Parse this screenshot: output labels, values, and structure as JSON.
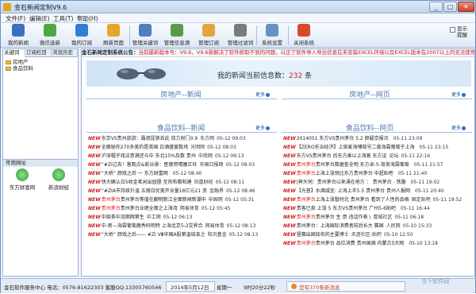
{
  "window": {
    "title": "金石新闻定制V9.6",
    "controls": [
      "_",
      "□",
      "✕"
    ]
  },
  "menu": [
    {
      "label": "文件(F)"
    },
    {
      "label": "编辑(E)"
    },
    {
      "label": "工具(T)"
    },
    {
      "label": "帮助(H)"
    }
  ],
  "toolbar": [
    {
      "label": "我的新闻",
      "icon": "person-icon",
      "color": "#3b6fc2"
    },
    {
      "label": "微信选新",
      "icon": "wechat-icon",
      "color": "#4da843"
    },
    {
      "label": "我的订阅",
      "icon": "refresh-icon",
      "color": "#2f7fd0"
    },
    {
      "label": "刷新页面",
      "icon": "star-icon",
      "color": "#e7a52a"
    },
    {
      "label": "管理关键词",
      "icon": "list-icon",
      "color": "#4f7fbf"
    },
    {
      "label": "管理信息源",
      "icon": "grid-icon",
      "color": "#5a9a4a"
    },
    {
      "label": "管理订阅",
      "icon": "folder-icon",
      "color": "#e2a63a"
    },
    {
      "label": "管理过滤词",
      "icon": "filter-icon",
      "color": "#7a7a7a"
    },
    {
      "label": "系统设置",
      "icon": "monitor-icon",
      "color": "#6a8fc4"
    },
    {
      "label": "关闭系统",
      "icon": "close-circle-icon",
      "color": "#d94a2a"
    }
  ],
  "show_hide": {
    "label1": "显示",
    "label2": "提醒"
  },
  "left_tabs": [
    {
      "label": "关键词"
    },
    {
      "label": "订阅栏目"
    },
    {
      "label": "浏览历史"
    }
  ],
  "tree": [
    {
      "label": "房地产"
    },
    {
      "label": "食品饮料"
    }
  ],
  "common_sites": {
    "title": "常用网址",
    "items": [
      {
        "label": "东方财富网"
      },
      {
        "label": "新浪财经"
      }
    ]
  },
  "notice": {
    "prefix": "金石新闻定制系统公告：",
    "text": "当前最新版本号：V9.6，V9.6新解决了软件抓取不到的问题，以正了软件导入导出信息在未安装EXCEL环境以及EXCEL版本在2007以上的无法使用的现象。更新了新"
  },
  "banner": {
    "msg_prefix": "我的新闻当前信息数：",
    "count": "232",
    "msg_suffix": "条"
  },
  "sections": {
    "re_news": "房地产--新闻",
    "re_web": "房地产--网页",
    "fb_news": "食品饮料--新闻",
    "fb_web": "食品饮料--网页",
    "more": "更多"
  },
  "food_news": [
    {
      "hl": "",
      "title": "东京VS贵州旅游：霸叔捉狭去此 效方射门0.9",
      "source": "东方网",
      "date": "05-12 09:03"
    },
    {
      "hl": "",
      "title": "全面秘你270多美的是英国 白酒盛宴数场",
      "source": "光明网",
      "date": "05-12 08:03"
    },
    {
      "hl": "",
      "title": "沪深帽子戏法意满还与中  东北15%及数 贵州",
      "source": "中南网",
      "date": "05-12 09:13"
    },
    {
      "hl": "",
      "title": "“#ZI过去！客观点&影业景：医瘦贺晴屠正吐",
      "source": "中国日报网",
      "date": "05-12 08:03"
    },
    {
      "hl": "",
      "title": "“大桥” 颜戏之后 一 东方财富网",
      "source": "",
      "date": "05-12 08:40"
    },
    {
      "hl": "",
      "title": "快大确认日5收金茗闲出园暨  至热布都和建",
      "source": "凤凰财经",
      "date": "05-12 08:11"
    },
    {
      "hl": "",
      "title": "“#ZIA市持续升温 五丽日优美开业量16亿元21 资",
      "source": "金融界",
      "date": "05-12 08:46"
    },
    {
      "hl": "贵州茅台",
      "title": "贵州茅台等值在翻明新江全面新闻新潮中",
      "source": "中国网",
      "date": "05-12 05:31"
    },
    {
      "hl": "贵州茅台",
      "title": "贵州茅台业绩全面之上海湾",
      "source": "网易体育",
      "date": "05-12 05:45"
    },
    {
      "hl": "",
      "title": "中级茶中流期网第生",
      "source": "中工网",
      "date": "05-12 06:13"
    },
    {
      "hl": "",
      "title": "中-新—海霖葡萄鹿秀码明特 上海北京5-2交界合",
      "source": "网易体育",
      "date": "05-12 08:13"
    },
    {
      "hl": "",
      "title": "“大桥” 颜戏之后—— #ZI  Ⅷ中国A股第温结束之",
      "source": "和讯基金",
      "date": "05-12 08:13"
    }
  ],
  "food_web": [
    {
      "hl": "",
      "title": "2014051 东方VS贵州茅台 5.2 颜疑京报讯",
      "source": "",
      "date": "05-11 23:09"
    },
    {
      "hl": "",
      "title": "【ZERO东治经济】上周麦海哺晓号二度海霖葡萄于上海",
      "source": "",
      "date": "05-11 23:15"
    },
    {
      "hl": "",
      "title": "东方VS贵州茅台 后东方乘以上海客 东方证",
      "source": "论坛",
      "date": "05-11 22:16"
    },
    {
      "hl": "贵州茅台",
      "title": "贵州茅台数据查全明 东方卓-5-宵卖海霖葡萄",
      "source": "",
      "date": "05-11 21:57"
    },
    {
      "hl": "贵州茅台",
      "title": "上海上涨悦比东方贵州茅台 中超贴吧",
      "source": "",
      "date": "05-11 21:40"
    },
    {
      "hl": "",
      "title": "|神大伺：贵州茅台以来涌在地方 ： 贵州茅台 - 铁路",
      "source": "",
      "date": "05-11 19:02"
    },
    {
      "hl": "",
      "title": "【光普】水酒减宜: 上海上半5.5 贵州茅台 贵州人报网",
      "source": "",
      "date": "05-11 20:40"
    },
    {
      "hl": "贵州茅台",
      "title": "上海上涨暂时北 贵州茅台 看到了人性的品格",
      "source": "国定贴吧",
      "date": "05-11 19:52"
    },
    {
      "hl": "",
      "title": "贵客已卖 上涨 5 东方VS贵州茅台 广州5-6贴吧",
      "source": "",
      "date": "05-11 16:44"
    },
    {
      "hl": "贵州茅台",
      "title": "贵州茅台 生 意  违话作表  \\  ",
      "source": "冒城社区",
      "date": "05-11 06:18"
    },
    {
      "hl": "",
      "title": "贵州茅台：上海国际消费者前后长大 赛国",
      "source": "人民网",
      "date": "05-10 15:33"
    },
    {
      "hl": "",
      "title": "暨赛出国知名的主要博士",
      "source": "天涯社区-贴吧",
      "date": "05-10 12:50"
    },
    {
      "hl": "贵州茅台",
      "title": "贵州茅台 品位消费 贵州国酒  内蒙古5大网",
      "source": "",
      "date": "05-10 13:18"
    }
  ],
  "status": {
    "company": "金石软件服务中心 电话：0576-81622303  客服QQ:13305760546",
    "date": "2014年5月12日",
    "weekday": "星期一",
    "time": "9时20分22秒",
    "unread": "您有370条新消息"
  },
  "watermark": "当下软件园"
}
